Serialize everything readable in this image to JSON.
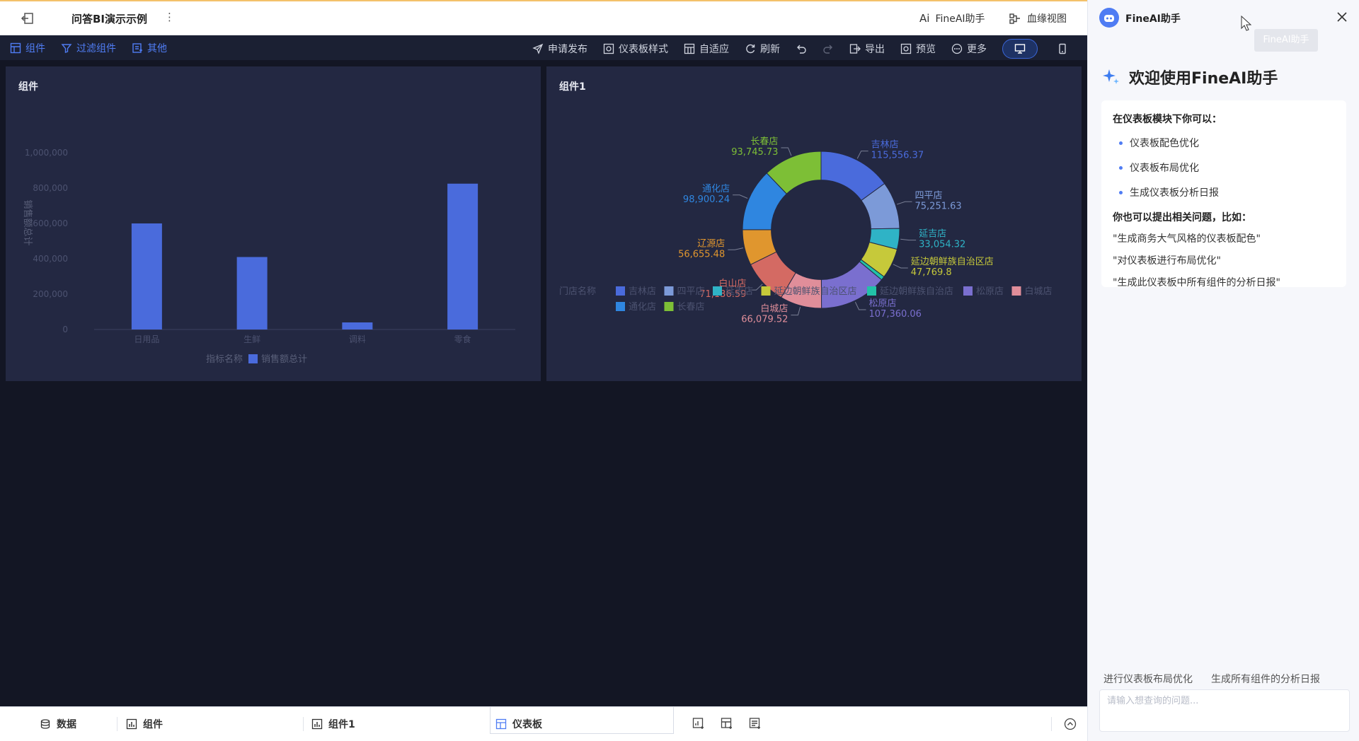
{
  "header": {
    "title": "问答BI演示示例",
    "more": "⋮",
    "ai_link": "FineAI助手",
    "ai_icon": "Ai",
    "lineage_link": "血缘视图"
  },
  "toolbar": {
    "left": [
      "组件",
      "过滤组件",
      "其他"
    ],
    "right": [
      "申请发布",
      "仪表板样式",
      "自适应",
      "刷新",
      "导出",
      "预览",
      "更多"
    ],
    "accent": "#4f7cf3"
  },
  "bar_panel": {
    "title": "组件",
    "ylabel": "销售额总计",
    "xlabel": "指标名称",
    "legend": "销售额总计"
  },
  "pie_panel": {
    "title": "组件1",
    "legend_title": "门店名称",
    "legend": [
      "吉林店",
      "四平店",
      "延吉店",
      "延边朝鲜族自治区店",
      "延边朝鲜族自治店",
      "松原店",
      "白城店",
      "通化店",
      "长春店"
    ]
  },
  "chart_data": [
    {
      "type": "bar",
      "title": "组件",
      "categories": [
        "日用品",
        "生鲜",
        "调料",
        "零食"
      ],
      "values": [
        600000,
        410000,
        40000,
        825000
      ],
      "xlabel": "指标名称",
      "ylabel": "销售额总计",
      "ylim": [
        0,
        1000000
      ],
      "yticks": [
        "0",
        "200,000",
        "400,000",
        "600,000",
        "800,000",
        "1,000,000"
      ],
      "series": [
        {
          "name": "销售额总计",
          "color": "#4a6bdc"
        }
      ],
      "grid": false,
      "legend": "bottom-center"
    },
    {
      "type": "pie",
      "title": "组件1",
      "donut": true,
      "legend_title": "门店名称",
      "legend": "bottom",
      "slices": [
        {
          "name": "吉林店",
          "value": 115556.37,
          "value_label": "115,556.37",
          "color": "#4a6bdc"
        },
        {
          "name": "四平店",
          "value": 75251.63,
          "value_label": "75,251.63",
          "color": "#7c9ad8"
        },
        {
          "name": "延吉店",
          "value": 33054.32,
          "value_label": "33,054.32",
          "color": "#2fb3c6"
        },
        {
          "name": "延边朝鲜族自治区店",
          "value": 47769.8,
          "value_label": "47,769.8",
          "color": "#c6c93a"
        },
        {
          "name": "延边朝鲜族自治店",
          "value": 6200,
          "value_label": "",
          "color": "#22c1a8"
        },
        {
          "name": "松原店",
          "value": 107360.06,
          "value_label": "107,360.06",
          "color": "#7a6fcf"
        },
        {
          "name": "白城店",
          "value": 66079.52,
          "value_label": "66,079.52",
          "color": "#e08e9a"
        },
        {
          "name": "白山店",
          "value": 71136.59,
          "value_label": "71,136.59",
          "color": "#d46a63"
        },
        {
          "name": "辽源店",
          "value": 56655.48,
          "value_label": "56,655.48",
          "color": "#e0962e"
        },
        {
          "name": "通化店",
          "value": 98900.24,
          "value_label": "98,900.24",
          "color": "#2f86e0"
        },
        {
          "name": "长春店",
          "value": 93745.73,
          "value_label": "93,745.73",
          "color": "#7dbf36"
        }
      ]
    }
  ],
  "bottombar": {
    "data": "数据",
    "widget": "组件",
    "widget1": "组件1",
    "dashboard": "仪表板"
  },
  "ai_panel": {
    "name": "FineAI助手",
    "tooltip": "FineAI助手",
    "welcome": "欢迎使用FineAI助手",
    "intro": "在仪表板模块下你可以：",
    "abilities": [
      "仪表板配色优化",
      "仪表板布局优化",
      "生成仪表板分析日报"
    ],
    "prompt_head": "你也可以提出相关问题，比如：",
    "examples": [
      "\"生成商务大气风格的仪表板配色\"",
      "\"对仪表板进行布局优化\"",
      "\"生成此仪表板中所有组件的分析日报\""
    ],
    "chips": [
      "进行仪表板布局优化",
      "生成所有组件的分析日报"
    ],
    "input_placeholder": "请输入想查询的问题..."
  }
}
